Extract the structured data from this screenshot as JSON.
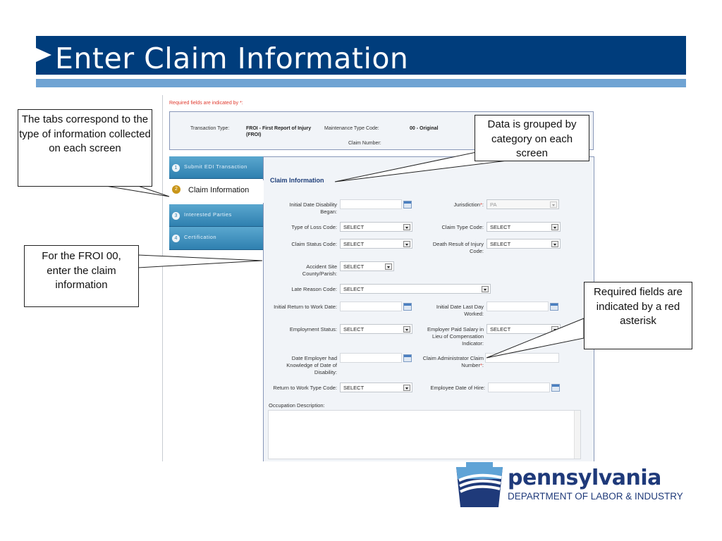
{
  "slide": {
    "title": "Enter Claim Information"
  },
  "form": {
    "required_note": "Required fields are indicated by *:",
    "header": {
      "transaction_type_label": "Transaction Type:",
      "transaction_type_value": "FROI - First Report of Injury",
      "transaction_type_value2": "(FROI)",
      "maintenance_type_label": "Maintenance Type Code:",
      "maintenance_type_value": "00 - Original",
      "claim_number_label": "Claim Number:"
    },
    "tabs": [
      {
        "num": "1",
        "label": "Submit EDI Transaction"
      },
      {
        "num": "2",
        "label": "Claim Information",
        "active": true
      },
      {
        "num": "3",
        "label": "Interested Parties"
      },
      {
        "num": "4",
        "label": "Certification"
      }
    ],
    "section_title": "Claim Information",
    "fields": {
      "initial_date_disability": {
        "label": "Initial Date Disability Began:",
        "value": ""
      },
      "jurisdiction": {
        "label": "Jurisdiction",
        "value": "PA",
        "required": true
      },
      "type_of_loss": {
        "label": "Type of Loss Code:",
        "value": "SELECT"
      },
      "claim_type": {
        "label": "Claim Type Code:",
        "value": "SELECT"
      },
      "claim_status": {
        "label": "Claim Status Code:",
        "value": "SELECT"
      },
      "death_result": {
        "label": "Death Result of Injury Code:",
        "value": "SELECT"
      },
      "accident_site": {
        "label": "Accident Site County/Parish:",
        "value": "SELECT"
      },
      "late_reason": {
        "label": "Late Reason Code:",
        "value": "SELECT"
      },
      "initial_return": {
        "label": "Initial Return to Work Date:",
        "value": ""
      },
      "last_day_worked": {
        "label": "Initial Date Last Day Worked:",
        "value": ""
      },
      "employment_status": {
        "label": "Employment Status:",
        "value": "SELECT"
      },
      "employer_paid_salary": {
        "label": "Employer Paid Salary in Lieu of Compensation Indicator:",
        "value": "SELECT"
      },
      "date_employer_knowledge": {
        "label": "Date Employer had Knowledge of Date of Disability:",
        "value": ""
      },
      "claim_admin_number": {
        "label": "Claim Administrator Claim Number",
        "value": "",
        "required": true
      },
      "return_to_work_type": {
        "label": "Return to Work Type Code:",
        "value": "SELECT"
      },
      "employee_date_hire": {
        "label": "Employee Date of Hire:",
        "value": ""
      },
      "occupation_description": {
        "label": "Occupation Description:",
        "value": ""
      }
    },
    "required_marker": "*",
    "colon": ":"
  },
  "callouts": {
    "tabs": "The tabs correspond to the type of information collected on each screen",
    "grouped": "Data is grouped by category on each screen",
    "froi": "For the FROI 00, enter the claim information",
    "required": "Required fields are indicated by a red asterisk"
  },
  "logo": {
    "name": "pennsylvania",
    "subtitle": "DEPARTMENT OF LABOR & INDUSTRY"
  },
  "colors": {
    "title_bar": "#003d7c",
    "stripe": "#6fa3d3",
    "tab": "#3a8dbd",
    "required": "#e03a2e"
  }
}
